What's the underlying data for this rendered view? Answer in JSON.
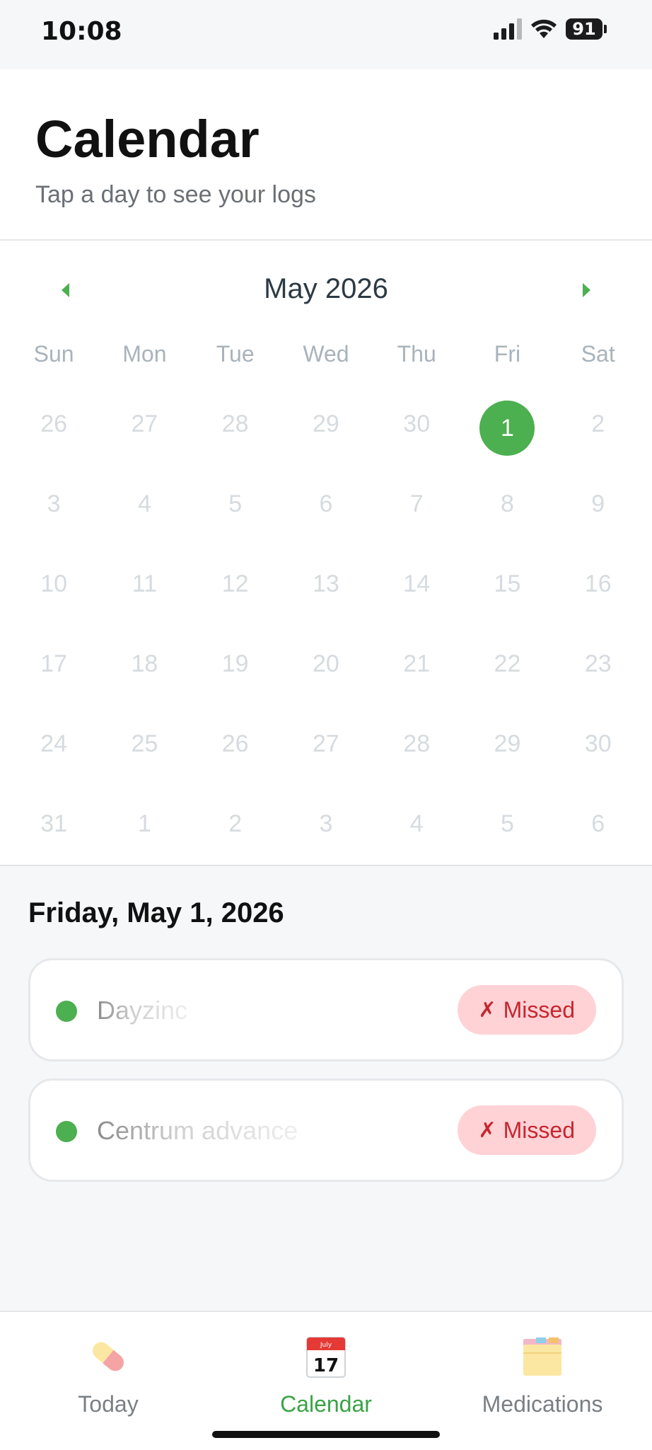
{
  "status_bar": {
    "time": "10:08",
    "battery": "91"
  },
  "header": {
    "title": "Calendar",
    "subtitle": "Tap a day to see your logs"
  },
  "calendar": {
    "month_label": "May 2026",
    "weekdays": [
      "Sun",
      "Mon",
      "Tue",
      "Wed",
      "Thu",
      "Fri",
      "Sat"
    ],
    "weeks": [
      [
        "26",
        "27",
        "28",
        "29",
        "30",
        "1",
        "2"
      ],
      [
        "3",
        "4",
        "5",
        "6",
        "7",
        "8",
        "9"
      ],
      [
        "10",
        "11",
        "12",
        "13",
        "14",
        "15",
        "16"
      ],
      [
        "17",
        "18",
        "19",
        "20",
        "21",
        "22",
        "23"
      ],
      [
        "24",
        "25",
        "26",
        "27",
        "28",
        "29",
        "30"
      ],
      [
        "31",
        "1",
        "2",
        "3",
        "4",
        "5",
        "6"
      ]
    ],
    "selected_day": "1",
    "accent_color": "#4caf50"
  },
  "logs": {
    "date_label": "Friday, May 1, 2026",
    "items": [
      {
        "name": "Dayzinc",
        "status": "Missed",
        "status_icon": "✗"
      },
      {
        "name": "Centrum advance",
        "status": "Missed",
        "status_icon": "✗"
      }
    ]
  },
  "tabs": [
    {
      "label": "Today",
      "icon": "pill-icon"
    },
    {
      "label": "Calendar",
      "icon": "calendar-icon",
      "active": true
    },
    {
      "label": "Medications",
      "icon": "card-index-icon"
    }
  ]
}
